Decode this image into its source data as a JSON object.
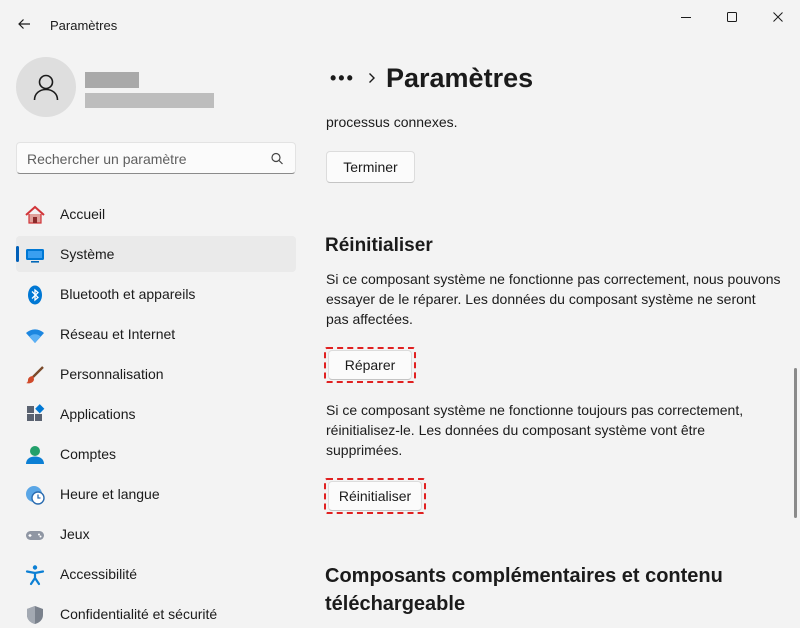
{
  "window": {
    "title": "Paramètres",
    "controls": {
      "minimize": "minimize",
      "maximize": "maximize",
      "close": "close"
    }
  },
  "search": {
    "placeholder": "Rechercher un paramètre"
  },
  "sidebar": {
    "items": [
      {
        "label": "Accueil",
        "icon": "home-icon",
        "active": false
      },
      {
        "label": "Système",
        "icon": "system-icon",
        "active": true
      },
      {
        "label": "Bluetooth et appareils",
        "icon": "bluetooth-icon",
        "active": false
      },
      {
        "label": "Réseau et Internet",
        "icon": "wifi-icon",
        "active": false
      },
      {
        "label": "Personnalisation",
        "icon": "brush-icon",
        "active": false
      },
      {
        "label": "Applications",
        "icon": "apps-icon",
        "active": false
      },
      {
        "label": "Comptes",
        "icon": "accounts-icon",
        "active": false
      },
      {
        "label": "Heure et langue",
        "icon": "clock-globe-icon",
        "active": false
      },
      {
        "label": "Jeux",
        "icon": "gamepad-icon",
        "active": false
      },
      {
        "label": "Accessibilité",
        "icon": "accessibility-icon",
        "active": false
      },
      {
        "label": "Confidentialité et sécurité",
        "icon": "shield-icon",
        "active": false
      }
    ]
  },
  "breadcrumb": {
    "more": "•••",
    "title": "Paramètres"
  },
  "main": {
    "clipped_text": "processus connexes.",
    "terminate_button": "Terminer",
    "reset_section": {
      "title": "Réinitialiser",
      "repair_description": "Si ce composant système ne fonctionne pas correctement, nous pouvons essayer de le réparer. Les données du composant système ne seront pas affectées.",
      "repair_button": "Réparer",
      "reset_description": "Si ce composant système ne fonctionne toujours pas correctement, réinitialisez-le. Les données du composant système vont être supprimées.",
      "reset_button": "Réinitialiser"
    },
    "addons_title": "Composants complémentaires et contenu téléchargeable"
  },
  "colors": {
    "accent": "#005fb8",
    "highlight": "#e02020",
    "background": "#f3f3f3"
  }
}
